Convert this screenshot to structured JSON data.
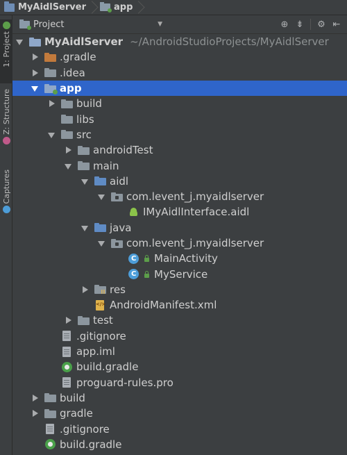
{
  "breadcrumb": {
    "project": "MyAidlServer",
    "module": "app"
  },
  "sidebar": {
    "tabs": [
      {
        "label": "1: Project"
      },
      {
        "label": "Z: Structure"
      },
      {
        "label": "Captures"
      }
    ]
  },
  "panel": {
    "view_mode": "Project"
  },
  "tree": {
    "root": {
      "name": "MyAidlServer",
      "path": "~/AndroidStudioProjects/MyAidlServer"
    },
    "items": [
      {
        "label": ".gradle"
      },
      {
        "label": ".idea"
      },
      {
        "label": "app"
      },
      {
        "label": "build"
      },
      {
        "label": "libs"
      },
      {
        "label": "src"
      },
      {
        "label": "androidTest"
      },
      {
        "label": "main"
      },
      {
        "label": "aidl"
      },
      {
        "label": "com.levent_j.myaidlserver"
      },
      {
        "label": "IMyAidlInterface.aidl"
      },
      {
        "label": "java"
      },
      {
        "label": "com.levent_j.myaidlserver"
      },
      {
        "label": "MainActivity"
      },
      {
        "label": "MyService"
      },
      {
        "label": "res"
      },
      {
        "label": "AndroidManifest.xml"
      },
      {
        "label": "test"
      },
      {
        "label": ".gitignore"
      },
      {
        "label": "app.iml"
      },
      {
        "label": "build.gradle"
      },
      {
        "label": "proguard-rules.pro"
      },
      {
        "label": "build"
      },
      {
        "label": "gradle"
      },
      {
        "label": ".gitignore"
      },
      {
        "label": "build.gradle"
      }
    ]
  }
}
